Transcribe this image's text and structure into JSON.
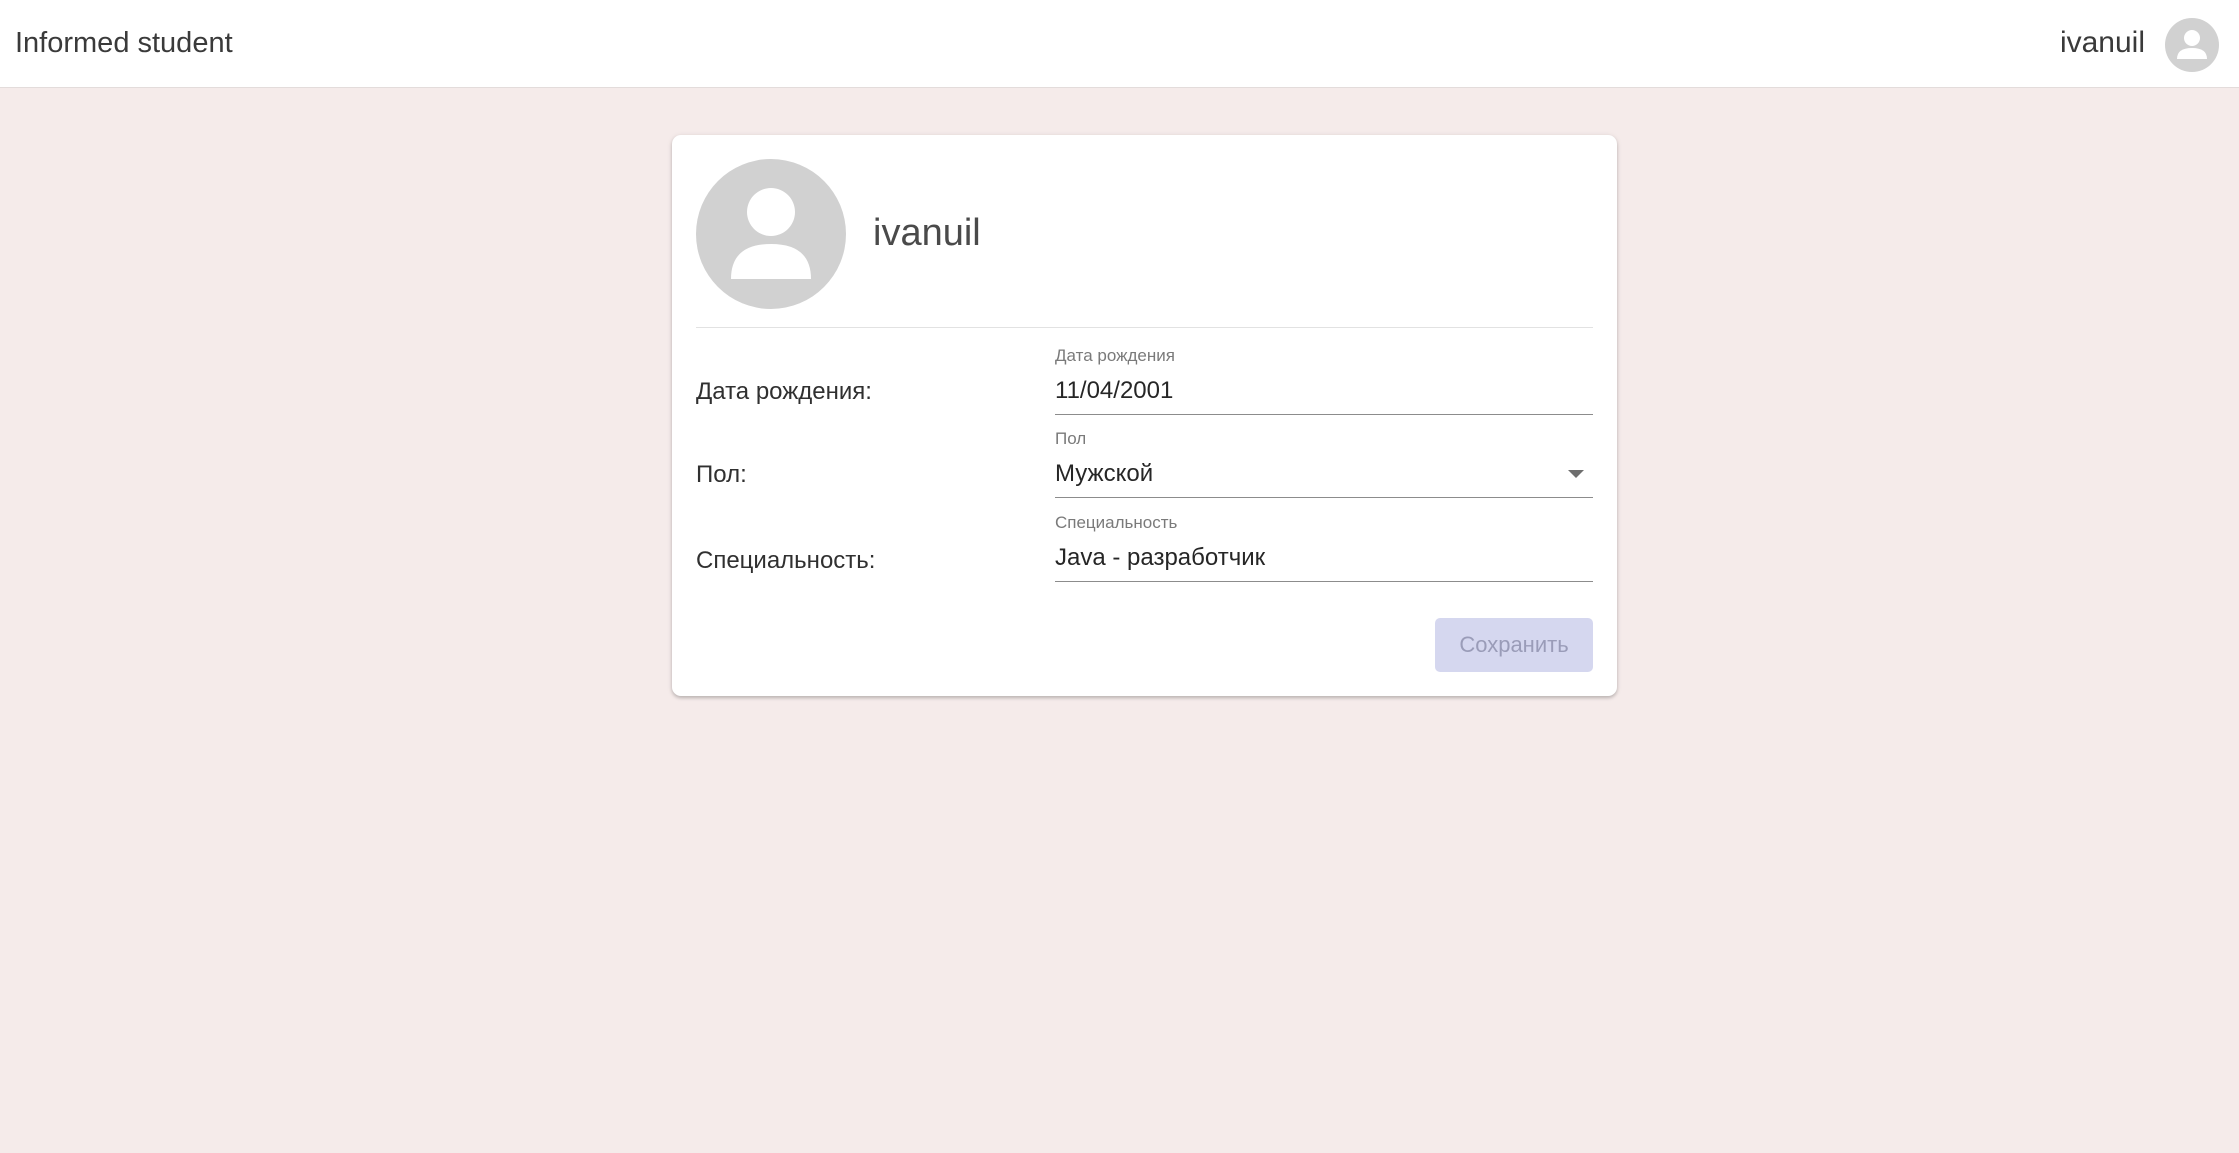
{
  "header": {
    "app_title": "Informed student",
    "username": "ivanuil"
  },
  "profile": {
    "username": "ivanuil",
    "avatar_icon": "person-icon"
  },
  "form": {
    "birthdate": {
      "row_label": "Дата рождения:",
      "caption": "Дата рождения",
      "value": "11/04/2001"
    },
    "gender": {
      "row_label": "Пол:",
      "caption": "Пол",
      "value": "Мужской"
    },
    "specialty": {
      "row_label": "Специальность:",
      "caption": "Специальность",
      "value": "Java - разработчик"
    },
    "save_label": "Сохранить"
  },
  "colors": {
    "page_background": "#f5ebea",
    "avatar_background": "#d1d1d1",
    "save_button_background": "#d5d7ef",
    "save_button_text": "#9a9cb8"
  }
}
